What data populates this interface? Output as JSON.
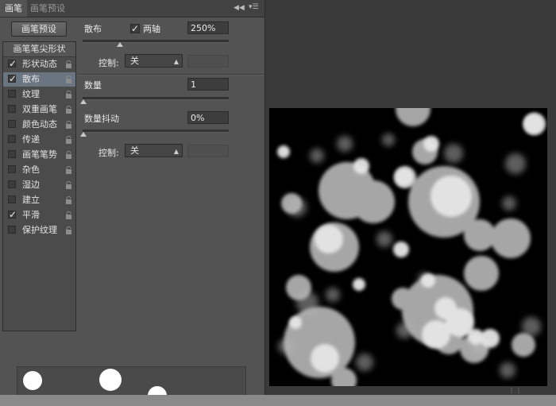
{
  "tabs": [
    {
      "label": "画笔",
      "active": true
    },
    {
      "label": "画笔预设",
      "active": false
    }
  ],
  "panel_icons": {
    "collapse": "double-chevron-left-icon",
    "menu": "panel-menu-icon"
  },
  "presets_button": "画笔预设",
  "list": {
    "header": "画笔笔尖形状",
    "items": [
      {
        "label": "形状动态",
        "checked": true,
        "selected": false
      },
      {
        "label": "散布",
        "checked": true,
        "selected": true
      },
      {
        "label": "纹理",
        "checked": false,
        "selected": false
      },
      {
        "label": "双重画笔",
        "checked": false,
        "selected": false
      },
      {
        "label": "颜色动态",
        "checked": false,
        "selected": false
      },
      {
        "label": "传递",
        "checked": false,
        "selected": false
      },
      {
        "label": "画笔笔势",
        "checked": false,
        "selected": false
      },
      {
        "label": "杂色",
        "checked": false,
        "selected": false
      },
      {
        "label": "湿边",
        "checked": false,
        "selected": false
      },
      {
        "label": "建立",
        "checked": false,
        "selected": false
      },
      {
        "label": "平滑",
        "checked": true,
        "selected": false
      },
      {
        "label": "保护纹理",
        "checked": false,
        "selected": false
      }
    ]
  },
  "scatter": {
    "label": "散布",
    "both_axes_label": "两轴",
    "both_axes_checked": true,
    "value": "250%",
    "control_label": "控制:",
    "control_value": "关"
  },
  "count": {
    "label": "数量",
    "value": "1"
  },
  "count_jitter": {
    "label": "数量抖动",
    "value": "0%",
    "control_label": "控制:",
    "control_value": "关"
  },
  "colors": {
    "selected_row": "#6b7582",
    "panel": "#535353",
    "canvas": "#000000"
  }
}
